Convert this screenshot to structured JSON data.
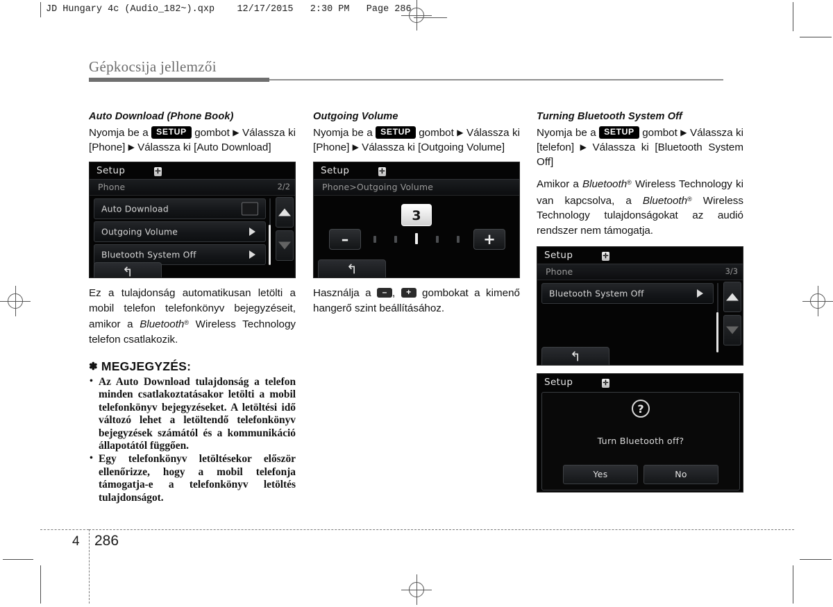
{
  "print_header": {
    "text": "JD Hungary 4c (Audio_182~).qxp    12/17/2015   2:30 PM   Page 286"
  },
  "chapter_title": "Gépkocsija jellemzői",
  "footer": {
    "chapter_number": "4",
    "page_number": "286"
  },
  "columns": {
    "col1": {
      "section_title": "Auto Download (Phone Book)",
      "step_prefix": "Nyomja be a",
      "setup_key": "SETUP",
      "step_after_key": "gombot",
      "arrow": "▶",
      "step_line2": "Válassza ki [Phone]",
      "step_line2b": "Válassza ki [Auto Download]",
      "screen": {
        "title": "Setup",
        "bt_icon": "bluetooth-icon",
        "bt_glyph": "✛",
        "sub_label": "Phone",
        "page_indicator": "2/2",
        "rows": [
          {
            "label": "Auto Download",
            "control": "checkbox",
            "checked": false
          },
          {
            "label": "Outgoing Volume",
            "control": "arrow"
          },
          {
            "label": "Bluetooth System Off",
            "control": "arrow"
          }
        ],
        "up_button": "scroll-up",
        "down_button": "scroll-down",
        "back_button": "↰"
      },
      "caption_part1": "Ez a tulajdonság automatikusan letölti a mobil telefon telefonkönyv bejegyzéseit, amikor a ",
      "caption_bt": "Bluetooth",
      "caption_reg": "®",
      "caption_part2": " Wireless Technology telefon csatlakozik."
    },
    "col2": {
      "section_title": "Outgoing Volume",
      "step_prefix": "Nyomja be a",
      "setup_key": "SETUP",
      "step_after_key": "gombot",
      "arrow": "▶",
      "step_line2": "Válassza ki [Phone]",
      "step_line2b": "Válassza ki [Outgoing Volume]",
      "screen": {
        "title": "Setup",
        "bt_icon": "bluetooth-icon",
        "bt_glyph": "✛",
        "breadcrumb": "Phone>Outgoing Volume",
        "value": "3",
        "minus_label": "–",
        "plus_label": "+",
        "ticks_total": 5,
        "tick_active_index": 2,
        "back_button": "↰"
      },
      "caption_part1": "Használja a ",
      "caption_minus": "–",
      "caption_comma": ", ",
      "caption_plus": "+",
      "caption_part2": " gombokat a kimenő hangerő szint beállításához."
    },
    "col3": {
      "section_title": "Turning Bluetooth System Off",
      "step_prefix": "Nyomja be a",
      "setup_key": "SETUP",
      "step_after_key": "gombot",
      "arrow": "▶",
      "step_line2": "Válassza ki [telefon]",
      "step_line2b": "Válassza ki [Bluetooth System Off]",
      "note_part1": "Amikor a ",
      "note_bt1": "Bluetooth",
      "note_reg1": "®",
      "note_part2": " Wireless Technology ki van kapcsolva, a ",
      "note_bt2": "Bluetooth",
      "note_reg2": "®",
      "note_part3": " Wireless Technology tulajdonságokat az audió rendszer nem támogatja.",
      "screen1": {
        "title": "Setup",
        "bt_icon": "bluetooth-icon",
        "bt_glyph": "✛",
        "sub_label": "Phone",
        "page_indicator": "3/3",
        "rows": [
          {
            "label": "Bluetooth System Off",
            "control": "arrow"
          }
        ],
        "up_button": "scroll-up",
        "down_button": "scroll-down",
        "back_button": "↰"
      },
      "screen2": {
        "title": "Setup",
        "bt_icon": "bluetooth-icon",
        "bt_glyph": "✛",
        "question_icon": "?",
        "message": "Turn Bluetooth off?",
        "yes_label": "Yes",
        "no_label": "No"
      }
    }
  },
  "note": {
    "asterisk": "✽",
    "heading": "MEGJEGYZÉS:",
    "items": [
      "Az Auto Download tulajdonság a telefon minden csatlakoztatásakor letölti a mobil telefonkönyv bejegyzéseket. A letöltési idő változó lehet a letöltendő telefonkönyv bejegyzések számától és a kommunikáció állapotától függően.",
      "Egy telefonkönyv letöltésekor először ellenőrizze, hogy a mobil telefonja támogatja-e a telefonkönyv letöltés tulajdonságot."
    ]
  },
  "colors": {
    "title_gray": "#6b6b6b",
    "rule_dark": "#6f6f6f",
    "lcd_bg": "#050505",
    "lcd_text": "#d7d7d7"
  }
}
